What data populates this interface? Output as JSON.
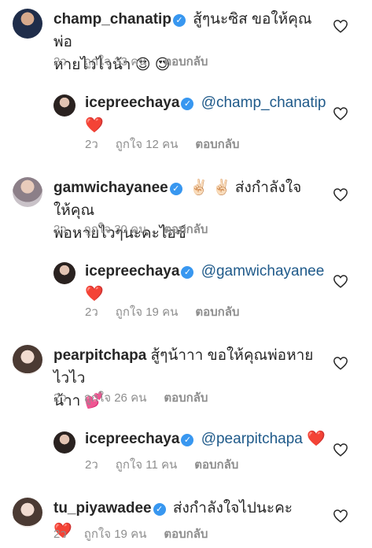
{
  "comments": [
    {
      "user": "champ_chanatip",
      "text": "สู้ๆนะซิส  ขอให้คุณพ่อ",
      "text2": "หายไวไวน้า",
      "emoji": "😍 😍",
      "time": "2ว",
      "likes": "ถูกใจ 33 คน",
      "reply": "ตอบกลับ"
    },
    {
      "user": "icepreechaya",
      "mention": "@champ_chanatip",
      "emoji": "❤️",
      "time": "2ว",
      "likes": "ถูกใจ 12 คน",
      "reply": "ตอบกลับ"
    },
    {
      "user": "gamwichayanee",
      "emoji": "✌🏻 ✌🏻",
      "text": "ส่งกำลังใจให้คุณ",
      "text2": "พ่อหายไวๆนะคะไอซ์",
      "time": "2ว",
      "likes": "ถูกใจ 30 คน",
      "reply": "ตอบกลับ"
    },
    {
      "user": "icepreechaya",
      "mention": "@gamwichayanee",
      "emoji": "❤️",
      "time": "2ว",
      "likes": "ถูกใจ 19 คน",
      "reply": "ตอบกลับ"
    },
    {
      "user": "pearpitchapa",
      "text": "สู้ๆน้าาา ขอให้คุณพ่อหายไวไว",
      "text2": "น้าา",
      "emoji": "💕",
      "time": "2ว",
      "likes": "ถูกใจ 26 คน",
      "reply": "ตอบกลับ"
    },
    {
      "user": "icepreechaya",
      "mention": "@pearpitchapa",
      "emoji": "❤️",
      "time": "2ว",
      "likes": "ถูกใจ 11 คน",
      "reply": "ตอบกลับ"
    },
    {
      "user": "tu_piyawadee",
      "text": "ส่งกำลังใจไปนะคะ",
      "emoji": "❤️",
      "time": "2ว",
      "likes": "ถูกใจ 19 คน",
      "reply": "ตอบกลับ"
    }
  ],
  "icons": {
    "like": "heart-outline-icon",
    "verified": "verified-badge-icon"
  },
  "colors": {
    "verified": "#3897f0",
    "meta": "#8e8e8e",
    "mention": "#1f5a8a"
  }
}
